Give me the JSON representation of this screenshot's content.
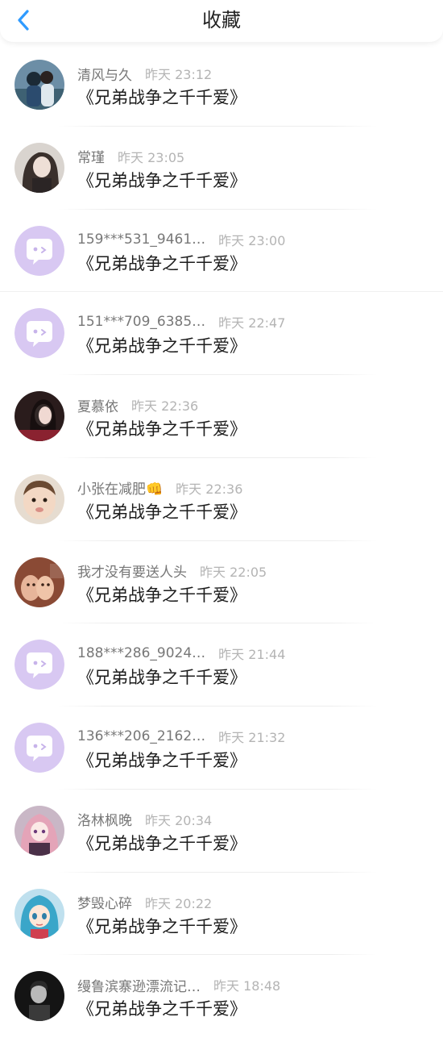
{
  "header": {
    "title": "收藏",
    "back_icon": "chevron-left-icon",
    "accent_color": "#2f9bff"
  },
  "rows": [
    {
      "name": "清风与久",
      "time": "昨天 23:12",
      "title": "《兄弟战争之千千爱》",
      "avatar": "photo-couple"
    },
    {
      "name": "常瑾",
      "time": "昨天 23:05",
      "title": "《兄弟战争之千千爱》",
      "avatar": "photo-woman"
    },
    {
      "name": "159***531_9461…",
      "time": "昨天 23:00",
      "title": "《兄弟战争之千千爱》",
      "avatar": "default-chat"
    },
    {
      "name": "151***709_6385…",
      "time": "昨天 22:47",
      "title": "《兄弟战争之千千爱》",
      "avatar": "default-chat"
    },
    {
      "name": "夏慕依",
      "time": "昨天 22:36",
      "title": "《兄弟战争之千千爱》",
      "avatar": "photo-girl-dark"
    },
    {
      "name": "小张在减肥👊",
      "time": "昨天 22:36",
      "title": "《兄弟战争之千千爱》",
      "avatar": "photo-baby"
    },
    {
      "name": "我才没有要送人头",
      "time": "昨天 22:05",
      "title": "《兄弟战争之千千爱》",
      "avatar": "photo-cats"
    },
    {
      "name": "188***286_9024…",
      "time": "昨天 21:44",
      "title": "《兄弟战争之千千爱》",
      "avatar": "default-chat"
    },
    {
      "name": "136***206_2162…",
      "time": "昨天 21:32",
      "title": "《兄弟战争之千千爱》",
      "avatar": "default-chat"
    },
    {
      "name": "洛林枫晚",
      "time": "昨天 20:34",
      "title": "《兄弟战争之千千爱》",
      "avatar": "anime-pink"
    },
    {
      "name": "梦毁心碎",
      "time": "昨天 20:22",
      "title": "《兄弟战争之千千爱》",
      "avatar": "anime-blue"
    },
    {
      "name": "缦鲁滨寨逊漂流记…",
      "time": "昨天 18:48",
      "title": "《兄弟战争之千千爱》",
      "avatar": "photo-man-bw"
    }
  ]
}
